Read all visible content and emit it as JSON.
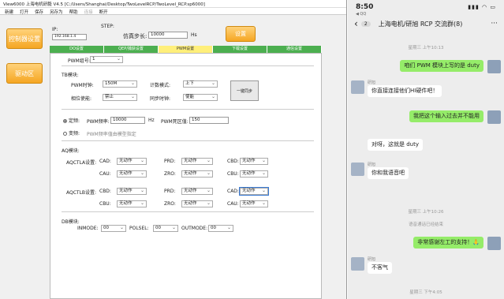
{
  "app": {
    "title": "View6000 上海电机研毅 V4.5 [C:/Users/Shanghai/Desktop/TwoLevelRCP/TwoLevel_RCP.sp6000]",
    "menu": [
      "新建",
      "打开",
      "保存",
      "另存为",
      "帮助",
      "连接",
      "断开"
    ],
    "btn_main": "控制器设置",
    "btn_side": "驱动区",
    "btn_set": "设置",
    "ip_label": "IP:",
    "ip_value": "192.168.1.4",
    "step_label": "STEP:",
    "sim_step_label": "仿真步长:",
    "sim_step_value": "10000",
    "sim_step_unit": "Hs",
    "tabs": [
      "DO设置",
      "QEP/捕获设置",
      "PWM设置",
      "下载设置",
      "通信设置"
    ],
    "pwm_group_label": "PWM组号:",
    "pwm_group_value": "1",
    "tb_title": "TB模块:",
    "pwm_clock_label": "PWM时钟:",
    "pwm_clock_value": "150M",
    "count_mode_label": "计数模式:",
    "count_mode_value": "上下",
    "phase_enable_label": "相位使能:",
    "phase_enable_value": "禁止",
    "sync_clock_label": "同步时钟:",
    "sync_clock_value": "使能",
    "sync_button": "一键同步",
    "fixed_freq_label": "定频:",
    "pwm_freq_label": "PWM频率:",
    "pwm_freq_value": "10000",
    "pwm_freq_unit": "Hz",
    "deadband_label": "PWM死区值:",
    "deadband_value": "150",
    "var_freq_label": "变频:",
    "var_freq_desc": "PWM频率值由模型指定",
    "aq_title": "AQ模块:",
    "aqctla_label": "AQCTLA设置:",
    "aqctlb_label": "AQCTLB设置:",
    "aq_rows": [
      {
        "l1": "CAD:",
        "v1": "无动作",
        "l2": "PRD:",
        "v2": "无动作",
        "l3": "CBD:",
        "v3": "无动作"
      },
      {
        "l1": "CAU:",
        "v1": "无动作",
        "l2": "ZRO:",
        "v2": "无动作",
        "l3": "CBU:",
        "v3": "无动作"
      },
      {
        "l1": "CBD:",
        "v1": "无动作",
        "l2": "PRD:",
        "v2": "无动作",
        "l3": "CAD:",
        "v3": "无动作"
      },
      {
        "l1": "CBU:",
        "v1": "无动作",
        "l2": "ZRO:",
        "v2": "无动作",
        "l3": "CAU:",
        "v3": "无动作"
      }
    ],
    "db_title": "DB模块:",
    "inmode_label": "INMODE:",
    "inmode_value": "00",
    "polsel_label": "POLSEL:",
    "polsel_value": "00",
    "outmode_label": "OUTMODE:",
    "outmode_value": "00"
  },
  "phone": {
    "clock": "8:50",
    "back_app": "◀ QQ",
    "status_icons": "▮▮▮ ◠ ▭",
    "unread": "2",
    "group_name": "上海电机/研旭 RCP 交流群(8)",
    "more": "···",
    "messages": [
      {
        "type": "time",
        "text": "星期三 上午10:13"
      },
      {
        "type": "me",
        "text": "咱们 PWM 模块上写的是 duty"
      },
      {
        "type": "them",
        "name": "研旭",
        "text": "你直接连接他们HI硬件吧！"
      },
      {
        "type": "me",
        "text": "我把这个输入过去并不能用"
      },
      {
        "type": "them",
        "name": "",
        "text": "对呀，这就是 duty"
      },
      {
        "type": "them",
        "name": "研旭",
        "text": "你和我语音吧"
      },
      {
        "type": "time",
        "text": "星期三 上午10:26"
      },
      {
        "type": "time",
        "text": "语音通话已经结束"
      },
      {
        "type": "me",
        "text": "非常感谢左工的支持！🙏"
      },
      {
        "type": "them",
        "name": "研旭",
        "text": "不客气"
      },
      {
        "type": "time",
        "text": "星期三 下午4:05"
      }
    ]
  },
  "colors": {
    "tab_green": "#4caf50",
    "tab_active": "#ffef7a",
    "orange": "#f5a623",
    "bubble_me": "#95ec69"
  }
}
